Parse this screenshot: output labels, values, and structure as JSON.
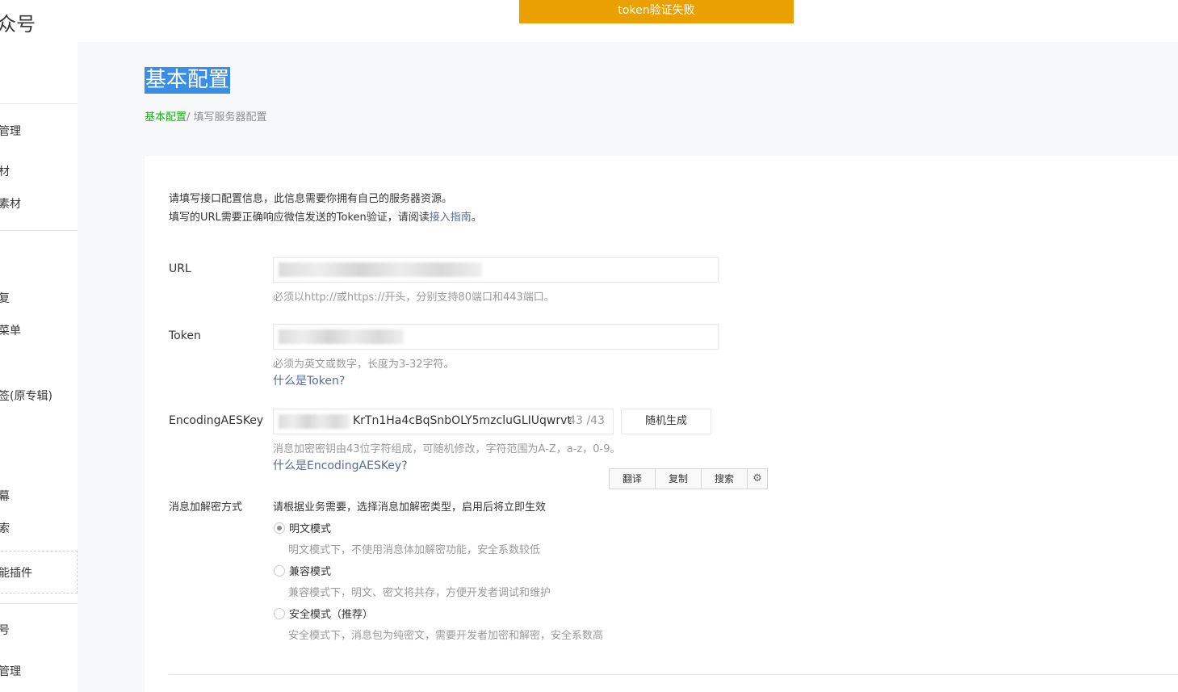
{
  "header": {
    "brand": "众号"
  },
  "toast": {
    "text": "token验证失败"
  },
  "sidebar": {
    "items": [
      {
        "label": "管理"
      },
      {
        "label": "材"
      },
      {
        "label": "素材"
      },
      {
        "label": "复"
      },
      {
        "label": "菜单"
      },
      {
        "label": "签(原专辑)"
      },
      {
        "label": "幕"
      },
      {
        "label": "索"
      },
      {
        "label": "能插件"
      },
      {
        "label": "号"
      },
      {
        "label": "管理"
      }
    ]
  },
  "page": {
    "title": "基本配置",
    "breadcrumb": {
      "root": "基本配置",
      "separator": "/ ",
      "current": "填写服务器配置"
    }
  },
  "intro": {
    "line1": "请填写接口配置信息，此信息需要你拥有自己的服务器资源。",
    "line2_prefix": "填写的URL需要正确响应微信发送的Token验证，请阅读",
    "line2_link": "接入指南",
    "line2_suffix": "。"
  },
  "form": {
    "url": {
      "label": "URL",
      "hint": "必须以http://或https://开头，分别支持80端口和443端口。"
    },
    "token": {
      "label": "Token",
      "hint": "必须为英文或数字，长度为3-32字符。",
      "help": "什么是Token?"
    },
    "aes": {
      "label": "EncodingAESKey",
      "value": "KrTn1Ha4cBqSnbOLY5mzcluGLIUqwrvt",
      "count": "43 /43",
      "generate_label": "随机生成",
      "hint": "消息加密密钥由43位字符组成，可随机修改，字符范围为A-Z，a-z，0-9。",
      "help": "什么是EncodingAESKey?"
    },
    "encryption": {
      "label": "消息加解密方式",
      "prompt": "请根据业务需要，选择消息加解密类型，启用后将立即生效",
      "options": [
        {
          "label": "明文模式",
          "desc": "明文模式下，不使用消息体加解密功能，安全系数较低",
          "checked": true
        },
        {
          "label": "兼容模式",
          "desc": "兼容模式下，明文、密文将共存，方便开发者调试和维护",
          "checked": false
        },
        {
          "label": "安全模式（推荐）",
          "desc": "安全模式下，消息包为纯密文，需要开发者加密和解密，安全系数高",
          "checked": false
        }
      ]
    }
  },
  "popup_toolbar": {
    "translate": "翻译",
    "copy": "复制",
    "search": "搜索",
    "settings_icon": "gear-icon"
  }
}
